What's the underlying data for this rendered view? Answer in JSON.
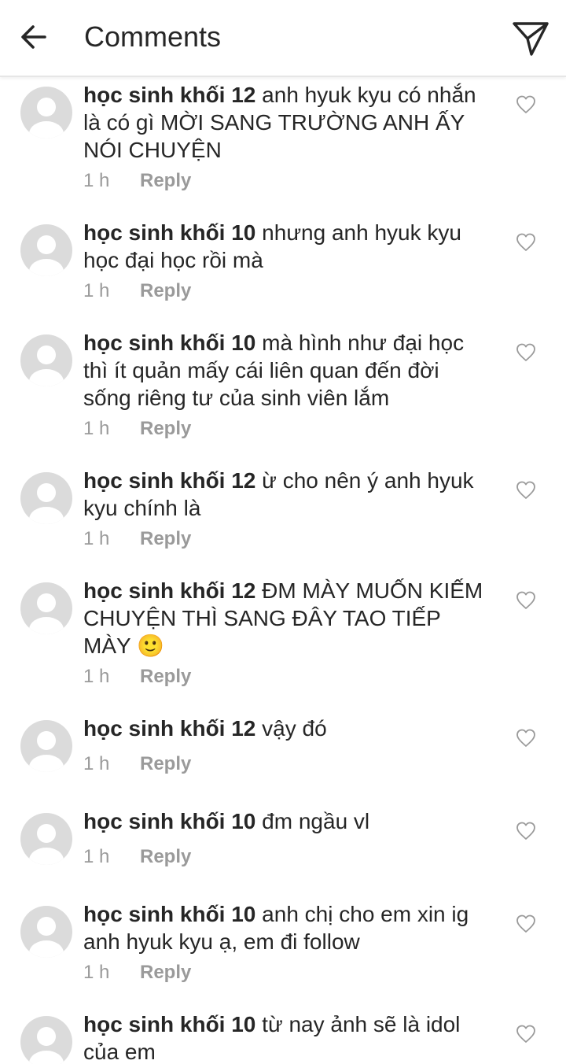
{
  "header": {
    "title": "Comments",
    "back_icon": "arrow-left-icon",
    "send_icon": "paper-plane-icon"
  },
  "comments": [
    {
      "username": "học sinh khối 12",
      "text": "anh hyuk kyu có nhắn là có gì MỜI SANG TRƯỜNG ANH ẤY NÓI CHUYỆN",
      "time": "1 h",
      "reply": "Reply"
    },
    {
      "username": "học sinh khối 10",
      "text": "nhưng anh hyuk kyu học đại học rồi mà",
      "time": "1 h",
      "reply": "Reply"
    },
    {
      "username": "học sinh khối 10",
      "text": "mà hình như đại học thì ít quản mấy cái liên quan đến đời sống riêng tư của sinh viên lắm",
      "time": "1 h",
      "reply": "Reply"
    },
    {
      "username": "học sinh khối 12",
      "text": "ừ cho nên ý anh hyuk kyu chính là",
      "time": "1 h",
      "reply": "Reply"
    },
    {
      "username": "học sinh khối 12",
      "text": "ĐM MÀY MUỐN KIẾM CHUYỆN THÌ SANG ĐÂY TAO TIẾP MÀY 🙂",
      "time": "1 h",
      "reply": "Reply"
    },
    {
      "username": "học sinh khối 12",
      "text": "vậy đó",
      "time": "1 h",
      "reply": "Reply"
    },
    {
      "username": "học sinh khối 10",
      "text": "đm ngầu vl",
      "time": "1 h",
      "reply": "Reply"
    },
    {
      "username": "học sinh khối 10",
      "text": "anh chị cho em xin ig anh hyuk kyu ạ, em đi follow",
      "time": "1 h",
      "reply": "Reply"
    },
    {
      "username": "học sinh khối 10",
      "text": "từ nay ảnh sẽ là idol của em",
      "time": "",
      "reply": ""
    }
  ]
}
